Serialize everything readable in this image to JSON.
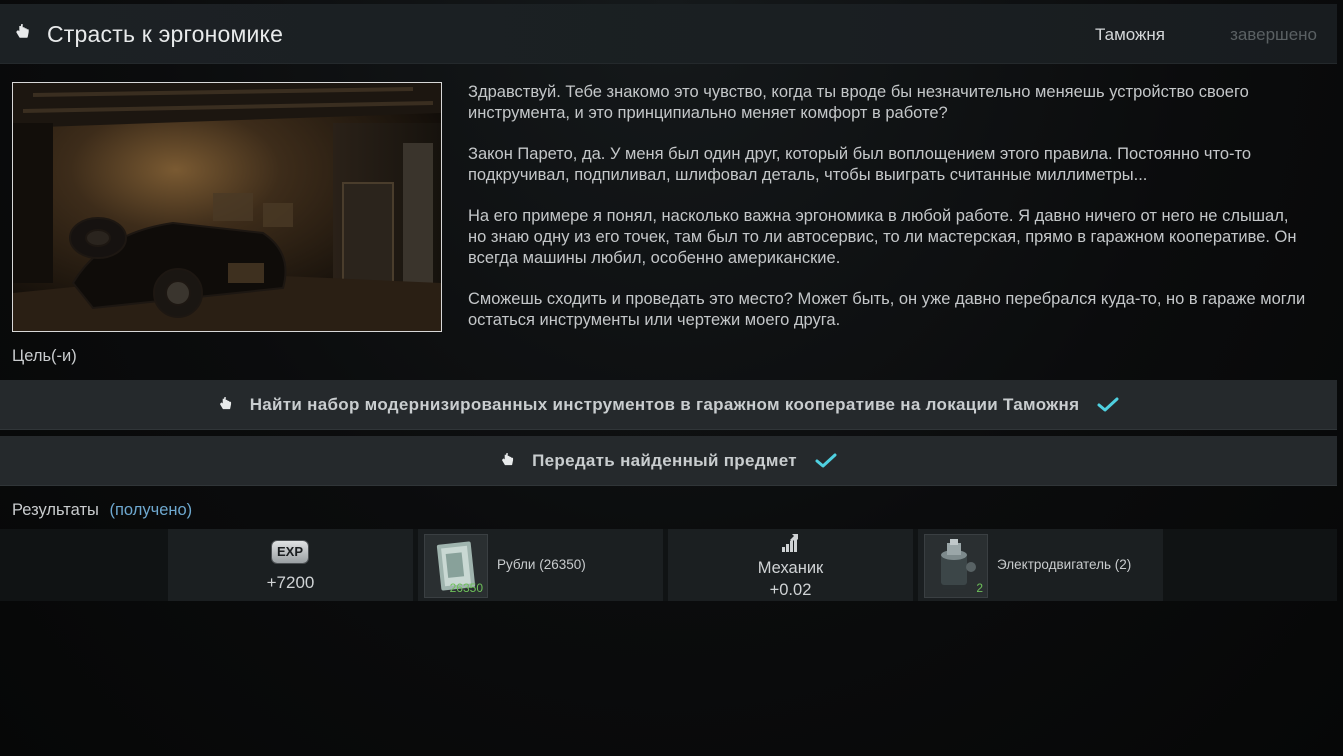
{
  "header": {
    "title": "Страсть к эргономике",
    "location": "Таможня",
    "status": "завершено"
  },
  "description": [
    "Здравствуй. Тебе знакомо это чувство, когда ты вроде бы незначительно меняешь устройство своего инструмента, и это принципиально меняет комфорт в работе?",
    "Закон Парето, да. У меня был один друг, который был воплощением этого правила. Постоянно что-то подкручивал, подпиливал, шлифовал деталь, чтобы выиграть считанные миллиметры...",
    "На его примере я понял, насколько важна эргономика в любой работе. Я давно ничего от него не слышал, но знаю одну из его точек, там был то ли автосервис, то ли мастерская, прямо в гаражном кооперативе. Он всегда машины любил, особенно американские.",
    "Сможешь сходить и проведать это место? Может быть, он уже давно перебрался куда-то, но в гараже могли остаться инструменты или чертежи моего друга."
  ],
  "goals_label": "Цель(-и)",
  "objectives": [
    {
      "text": "Найти набор модернизированных инструментов в гаражном кооперативе на локации Таможня",
      "completed": true
    },
    {
      "text": "Передать найденный предмет",
      "completed": true
    }
  ],
  "results": {
    "label": "Результаты",
    "received": "(получено)",
    "exp": {
      "badge": "EXP",
      "value": "+7200"
    },
    "roubles": {
      "name": "Рубли (26350)",
      "count": "26350"
    },
    "skill": {
      "name": "Механик",
      "value": "+0.02"
    },
    "motor": {
      "name": "Электродвигатель (2)",
      "count": "2"
    }
  },
  "colors": {
    "accent_check": "#4fd0e0",
    "received": "#6ea8cf",
    "count_green": "#6ec15a"
  }
}
